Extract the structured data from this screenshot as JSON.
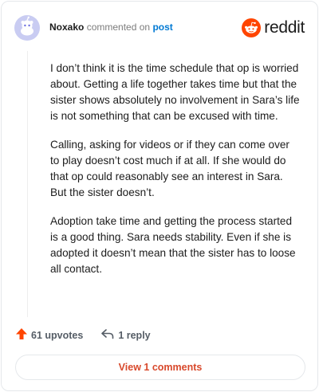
{
  "comment": {
    "username": "Noxako",
    "action_text": "commented on",
    "post_link": "post",
    "paragraphs": [
      "I don’t think it is the time schedule that op is worried about. Getting a life together takes time but that the sister shows absolutely no involvement in Sara’s life is not something that can be excused with time.",
      "Calling, asking for videos or if they can come over to play doesn’t cost much if at all. If she would do that op could reasonably see an interest in Sara. But the sister doesn’t.",
      "Adoption take time and getting the process started is a good thing. Sara needs stability. Even if she is adopted it doesn’t mean that the sister has to loose all contact."
    ]
  },
  "brand": {
    "name": "reddit",
    "color": "#ff4500"
  },
  "actions": {
    "upvotes": "61 upvotes",
    "replies": "1 reply"
  },
  "view_comments_label": "View 1 comments",
  "colors": {
    "link": "#0079d3",
    "accent": "#ff4500",
    "cta": "#d8492c"
  }
}
